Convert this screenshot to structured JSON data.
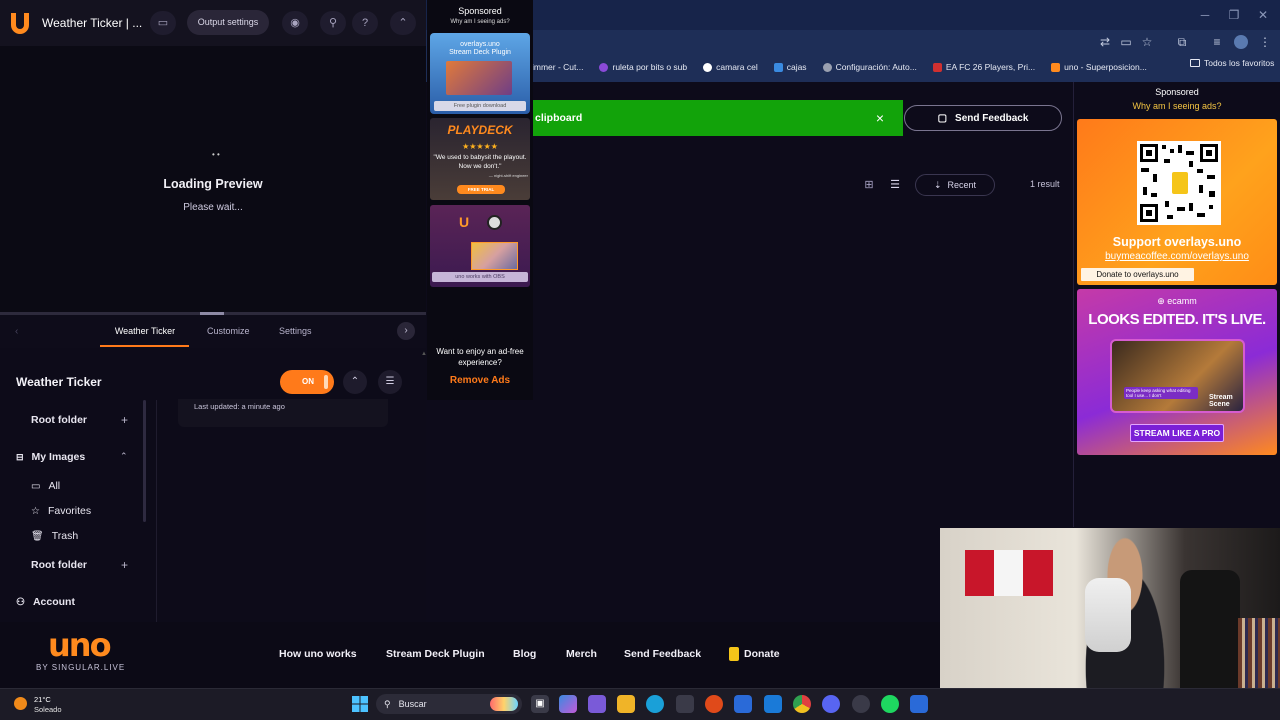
{
  "app": {
    "title": "Weather Ticker | ...",
    "output_settings": "Output settings",
    "preview": {
      "dots": "• •",
      "title": "Loading Preview",
      "subtitle": "Please wait..."
    },
    "tabs": [
      {
        "label": "Weather Ticker",
        "active": true
      },
      {
        "label": "Customize"
      },
      {
        "label": "Settings"
      }
    ],
    "item_title": "Weather Ticker",
    "toggle_label": "ON",
    "last_updated": "Last updated: a minute ago",
    "sidebar": [
      {
        "label": "Root folder",
        "icon": "plus-icon"
      },
      {
        "label": "My Images",
        "icon": "chevron-up-icon"
      },
      {
        "label": "All",
        "icon": "folder-icon"
      },
      {
        "label": "Favorites",
        "icon": "star-icon"
      },
      {
        "label": "Trash",
        "icon": "trash-icon"
      },
      {
        "label": "Root folder",
        "icon": "plus-icon"
      },
      {
        "label": "Account",
        "icon": "user-icon"
      }
    ]
  },
  "mid_ads": {
    "sponsored": "Sponsored",
    "why": "Why am I seeing ads?",
    "ad1_title": "overlays.uno\nStream Deck Plugin",
    "ad1_button": "Free plugin download",
    "ad2_logo": "PLAYDECK",
    "ad2_stars": "★★★★★",
    "ad2_quote": "\"We used to babysit the playout. Now we don't.\"",
    "ad2_attrib": "— night-shift engineer",
    "ad2_cta": "FREE TRIAL",
    "ad3_caption": "uno works with OBS",
    "enjoy": "Want to enjoy an ad-free experience?",
    "remove": "Remove Ads"
  },
  "browser": {
    "bookmarks": [
      {
        "label": "immer - Cut...",
        "color": "#d04040"
      },
      {
        "label": "ruleta por bits o sub",
        "color": "#8a4ad8"
      },
      {
        "label": "camara cel",
        "color": "#ffffff"
      },
      {
        "label": "cajas",
        "color": "#3a8ae0"
      },
      {
        "label": "Configuración: Auto...",
        "color": "#9aa0b0"
      },
      {
        "label": "EA FC 26 Players, Pri...",
        "color": "#d03030"
      },
      {
        "label": "uno - Superposicion...",
        "color": "#ff8a1e"
      }
    ],
    "bookmarks_right": "Todos los favoritos",
    "toast_text": "clipboard",
    "send_feedback": "Send Feedback",
    "recent": "Recent",
    "result_count": "1 result"
  },
  "right_ads": {
    "sponsored": "Sponsored",
    "why": "Why am I seeing ads?",
    "coffee_title": "Support overlays.uno",
    "coffee_url": "buymeacoffee.com/overlays.uno",
    "coffee_donate": "Donate to overlays.uno",
    "ecamm_logo": "⊕ ecamm",
    "ecamm_headline": "LOOKS EDITED. IT'S LIVE.",
    "ecamm_quote": "People keep asking what editing tool I use... I don't",
    "ecamm_badge": "Stream\nScene",
    "ecamm_cta": "STREAM LIKE A PRO"
  },
  "footer": {
    "logo": "uno",
    "by": "BY SINGULAR.LIVE",
    "links": [
      "How uno works",
      "Stream Deck Plugin",
      "Blog",
      "Merch",
      "Send Feedback",
      "Donate"
    ]
  },
  "taskbar": {
    "temp": "21°C",
    "condition": "Soleado",
    "search": "Buscar"
  },
  "colors": {
    "accent": "#ff7a1a",
    "toast": "#12a30a",
    "bg": "#0d0b19"
  }
}
